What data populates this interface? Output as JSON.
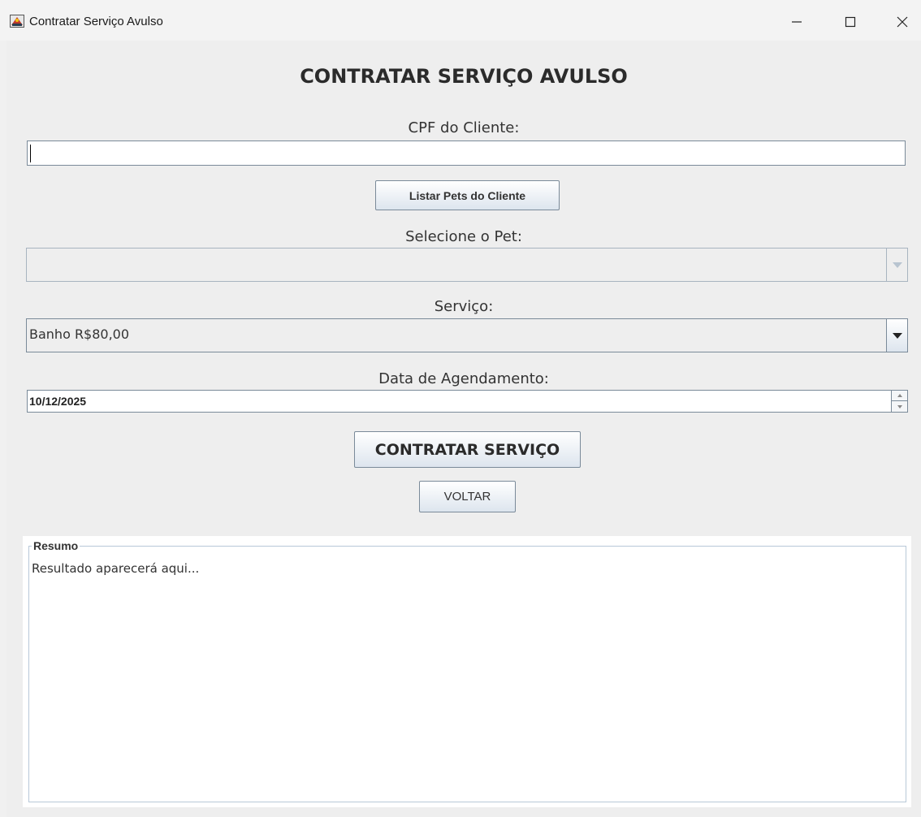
{
  "window": {
    "title": "Contratar Serviço Avulso",
    "controls": [
      "minimize-icon",
      "maximize-icon",
      "close-icon"
    ]
  },
  "form": {
    "heading": "CONTRATAR SERVIÇO AVULSO",
    "cpf_label": "CPF do Cliente:",
    "cpf_value": "",
    "list_pets_button": "Listar Pets do Cliente",
    "pet_label": "Selecione o Pet:",
    "pet_selected": "",
    "pet_enabled": false,
    "service_label": "Serviço:",
    "service_selected": "Banho R$80,00",
    "date_label": "Data de Agendamento:",
    "date_value": "10/12/2025",
    "contract_button": "CONTRATAR SERVIÇO",
    "back_button": "VOLTAR"
  },
  "summary": {
    "title": "Resumo",
    "text": "Resultado aparecerá aqui..."
  },
  "colors": {
    "background": "#eeeeee",
    "border": "#7a8a99",
    "button_gradient_end": "#dde5ee"
  }
}
